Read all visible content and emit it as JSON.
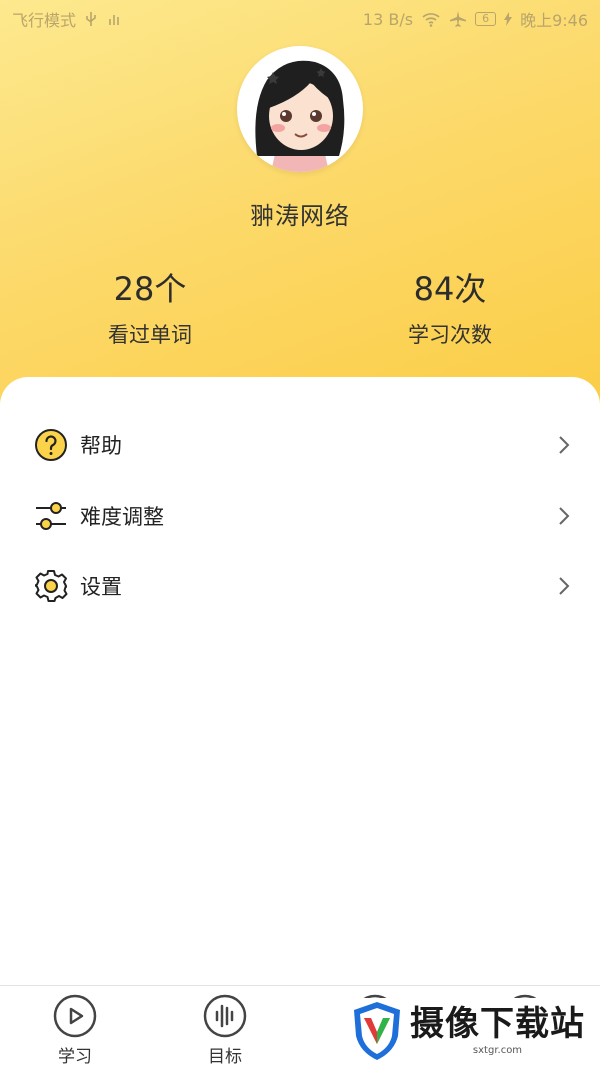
{
  "status_bar": {
    "left_text": "飞行模式",
    "net_speed": "13 B/s",
    "battery": "6",
    "time": "晚上9:46"
  },
  "profile": {
    "username": "翀涛网络"
  },
  "stats": [
    {
      "value": "28个",
      "label": "看过单词"
    },
    {
      "value": "84次",
      "label": "学习次数"
    }
  ],
  "menu": [
    {
      "label": "帮助",
      "icon": "help-icon"
    },
    {
      "label": "难度调整",
      "icon": "sliders-icon"
    },
    {
      "label": "设置",
      "icon": "gear-icon"
    }
  ],
  "tabs": [
    {
      "label": "学习",
      "icon": "play-icon"
    },
    {
      "label": "目标",
      "icon": "waveform-icon"
    }
  ],
  "watermark": {
    "title": "摄像下载站",
    "url": "sxtgr.com"
  },
  "colors": {
    "header_gradient_start": "#fde98f",
    "header_gradient_end": "#fbcd45",
    "accent_yellow": "#f8c62e"
  }
}
